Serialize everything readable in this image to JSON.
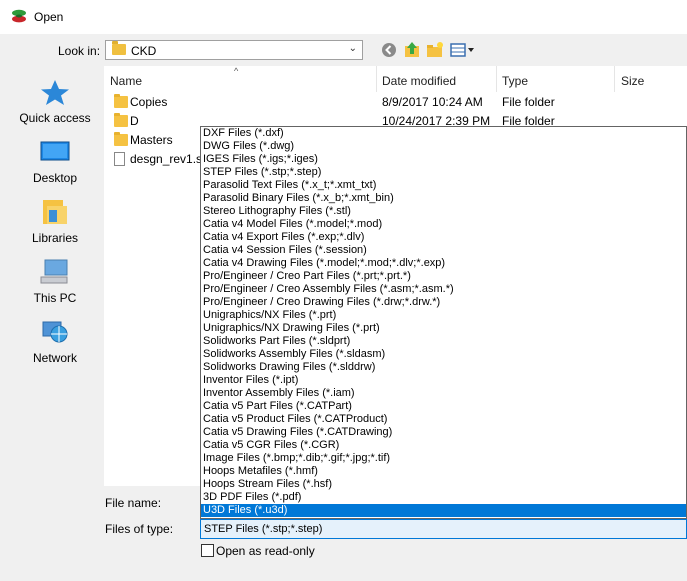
{
  "window": {
    "title": "Open"
  },
  "toolbar": {
    "lookin_label": "Look in:",
    "lookin_value": "CKD"
  },
  "places": [
    {
      "label": "Quick access",
      "icon": "star-icon"
    },
    {
      "label": "Desktop",
      "icon": "desktop-icon"
    },
    {
      "label": "Libraries",
      "icon": "libraries-icon"
    },
    {
      "label": "This PC",
      "icon": "computer-icon"
    },
    {
      "label": "Network",
      "icon": "network-icon"
    }
  ],
  "columns": {
    "name": "Name",
    "date": "Date modified",
    "type": "Type",
    "size": "Size"
  },
  "files": [
    {
      "name": "Copies",
      "date": "8/9/2017 10:24 AM",
      "type": "File folder",
      "icon": "folder-icon"
    },
    {
      "name": "D",
      "date": "10/24/2017 2:39 PM",
      "type": "File folder",
      "icon": "folder-icon"
    },
    {
      "name": "Masters",
      "date": "",
      "type": "",
      "icon": "folder-icon"
    },
    {
      "name": "desgn_rev1.st",
      "date": "",
      "type": "",
      "icon": "document-icon"
    }
  ],
  "fields": {
    "filename_label": "File name:",
    "filetype_label": "Files of type:",
    "filetype_value": "STEP Files (*.stp;*.step)",
    "readonly_label": "Open as read-only"
  },
  "filetype_options": [
    "DXF Files (*.dxf)",
    "DWG Files (*.dwg)",
    "IGES Files (*.igs;*.iges)",
    "STEP Files (*.stp;*.step)",
    "Parasolid Text Files (*.x_t;*.xmt_txt)",
    "Parasolid Binary Files (*.x_b;*.xmt_bin)",
    "Stereo Lithography Files (*.stl)",
    "Catia v4 Model Files (*.model;*.mod)",
    "Catia v4 Export Files (*.exp;*.dlv)",
    "Catia v4 Session Files (*.session)",
    "Catia v4 Drawing Files (*.model;*.mod;*.dlv;*.exp)",
    "Pro/Engineer / Creo Part Files (*.prt;*.prt.*)",
    "Pro/Engineer / Creo Assembly Files (*.asm;*.asm.*)",
    "Pro/Engineer / Creo Drawing Files (*.drw;*.drw.*)",
    "Unigraphics/NX Files (*.prt)",
    "Unigraphics/NX Drawing Files (*.prt)",
    "Solidworks Part Files (*.sldprt)",
    "Solidworks Assembly Files (*.sldasm)",
    "Solidworks Drawing Files (*.slddrw)",
    "Inventor Files (*.ipt)",
    "Inventor Assembly Files (*.iam)",
    "Catia v5 Part Files (*.CATPart)",
    "Catia v5 Product Files (*.CATProduct)",
    "Catia v5 Drawing Files (*.CATDrawing)",
    "Catia v5 CGR Files (*.CGR)",
    "Image Files (*.bmp;*.dib;*.gif;*.jpg;*.tif)",
    "Hoops Metafiles (*.hmf)",
    "Hoops Stream Files (*.hsf)",
    "3D PDF Files (*.pdf)",
    "U3D Files (*.u3d)"
  ],
  "selected_option_index": 29,
  "colors": {
    "selection": "#0078d7",
    "folder": "#f5c242"
  }
}
